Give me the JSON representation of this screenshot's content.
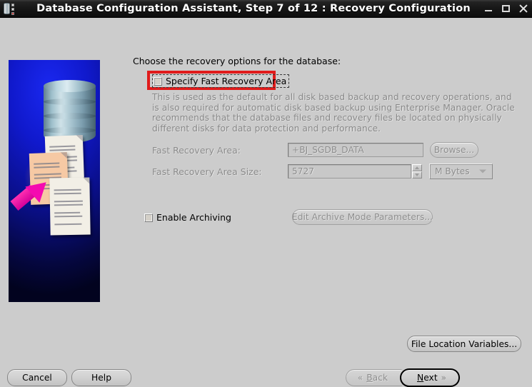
{
  "window": {
    "title": "Database Configuration Assistant, Step 7 of 12 : Recovery Configuration",
    "icon": "database-icon",
    "minimize_label": "_",
    "maximize_label": "□",
    "close_label": "✕"
  },
  "main": {
    "prompt": "Choose the recovery options for the database:",
    "specify_checkbox": {
      "label": "Specify Fast Recovery Area",
      "checked": false,
      "highlight_color": "#e01b1b",
      "focused": true
    },
    "description": "This is used as the default for all disk based backup and recovery operations, and is also required for automatic disk based backup using Enterprise Manager. Oracle recommends that the database files and recovery files be located on physically different disks for data protection and performance.",
    "fields": [
      {
        "label": "Fast Recovery Area:",
        "value": "+BJ_SGDB_DATA",
        "enabled": false
      },
      {
        "label": "Fast Recovery Area Size:",
        "value": "5727",
        "enabled": false
      }
    ],
    "units_dropdown": {
      "selected": "M Bytes",
      "enabled": false
    },
    "browse_button": {
      "label": "Browse...",
      "enabled": false
    },
    "archiving_checkbox": {
      "label": "Enable Archiving",
      "checked": false
    },
    "edit_archive_button": {
      "label": "Edit Archive Mode Parameters...",
      "enabled": false
    },
    "file_location_button": {
      "label": "File Location Variables...",
      "enabled": true
    }
  },
  "footer": {
    "cancel_label": "Cancel",
    "help_label": "Help",
    "back": {
      "prefix": "",
      "mnemonic": "B",
      "rest": "ack",
      "chevron": "«",
      "enabled": false
    },
    "next": {
      "mnemonic": "N",
      "rest": "ext",
      "chevron": "»",
      "focused": true
    }
  },
  "sidebar": {
    "graphic": "database-documents-arrow-illustration",
    "background_color": "#0a10a8",
    "arrow_color": "#f50ab0"
  },
  "theme": {
    "window_background": "#cccccc",
    "titlebar_background": "#151515",
    "titlebar_text": "#ffffff",
    "disabled_text": "#8a8a8a",
    "enabled_text": "#000000"
  }
}
